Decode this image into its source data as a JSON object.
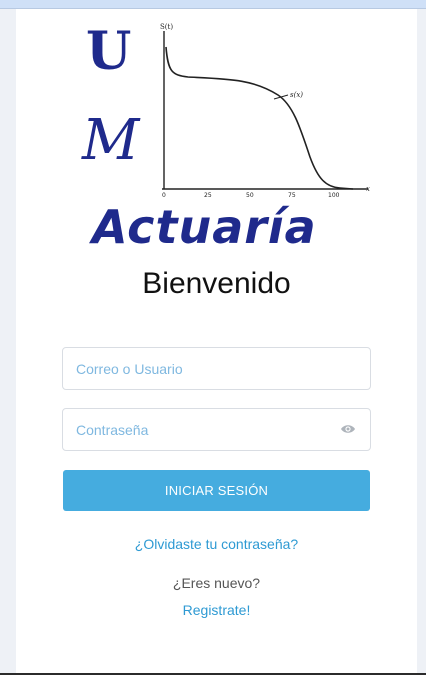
{
  "colors": {
    "brand": "#1f2a8c",
    "accent": "#45acdf",
    "link": "#2e9ad3"
  },
  "logo": {
    "letters": [
      "U",
      "M"
    ],
    "word": "Actuaría",
    "chart_labels": {
      "y_axis": "S(t)",
      "curve": "s(x)",
      "ticks": [
        "0",
        "25",
        "50",
        "75",
        "100"
      ],
      "x_axis": "x"
    }
  },
  "welcome": {
    "title": "Bienvenido"
  },
  "login": {
    "user_placeholder": "Correo o Usuario",
    "password_placeholder": "Contraseña",
    "password_toggle_icon": "eye-icon",
    "submit_label": "INICIAR SESIÓN",
    "forgot_label": "¿Olvidaste tu contraseña?",
    "new_question": "¿Eres nuevo?",
    "register_label": "Registrate!"
  }
}
